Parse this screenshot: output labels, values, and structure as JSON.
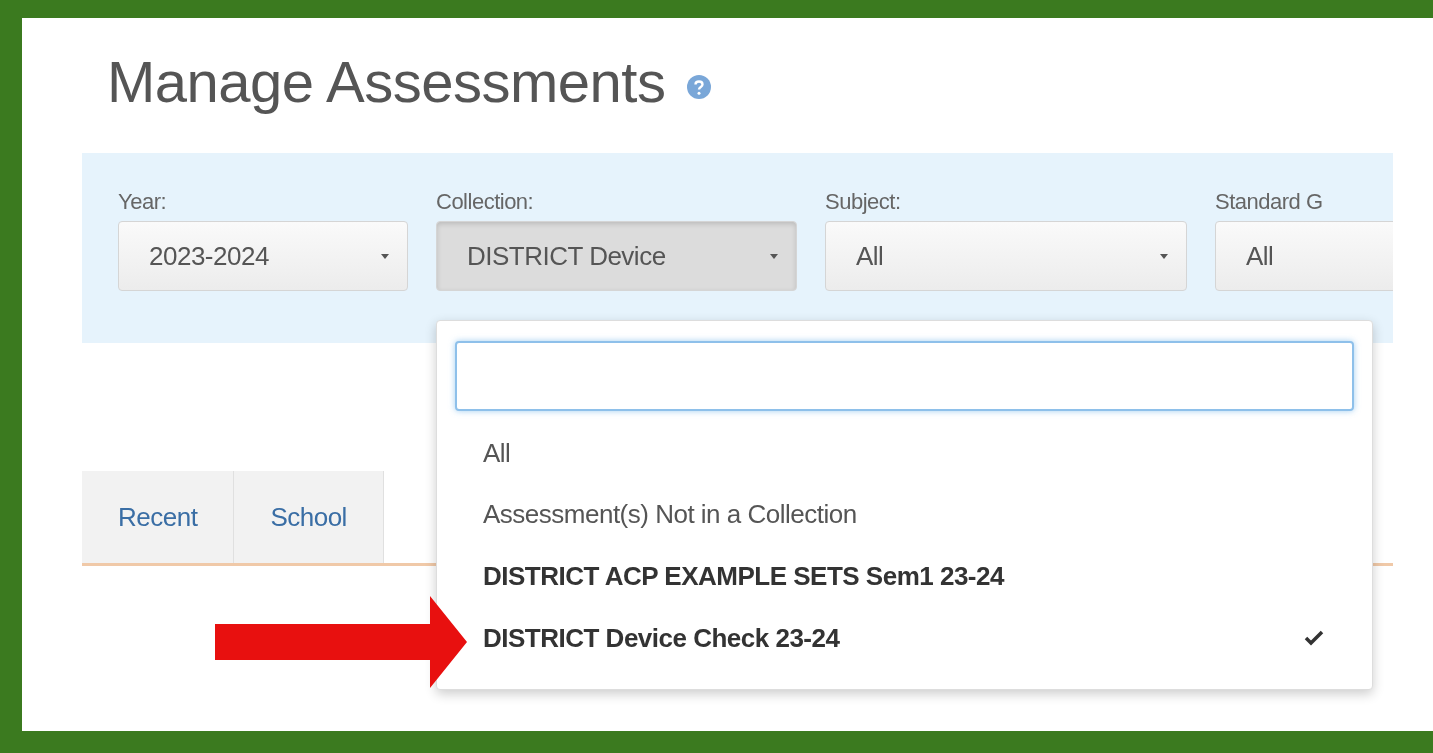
{
  "page": {
    "title": "Manage Assessments"
  },
  "filters": [
    {
      "label": "Year:",
      "value": "2023-2024",
      "open": false
    },
    {
      "label": "Collection:",
      "value": "DISTRICT Device",
      "open": true
    },
    {
      "label": "Subject:",
      "value": "All",
      "open": false
    },
    {
      "label": "Standard G",
      "value": "All",
      "open": false
    }
  ],
  "tabs": [
    {
      "label": "Recent"
    },
    {
      "label": "School"
    }
  ],
  "dropdown": {
    "options": [
      {
        "label": "All",
        "kind": "plain",
        "selected": false
      },
      {
        "label": "Assessment(s) Not in a Collection",
        "kind": "plain",
        "selected": false
      },
      {
        "label": "DISTRICT ACP EXAMPLE SETS Sem1 23-24",
        "kind": "collection",
        "selected": false
      },
      {
        "label": "DISTRICT Device Check 23-24",
        "kind": "collection",
        "selected": true
      }
    ]
  },
  "annotation": {
    "kind": "arrow"
  }
}
